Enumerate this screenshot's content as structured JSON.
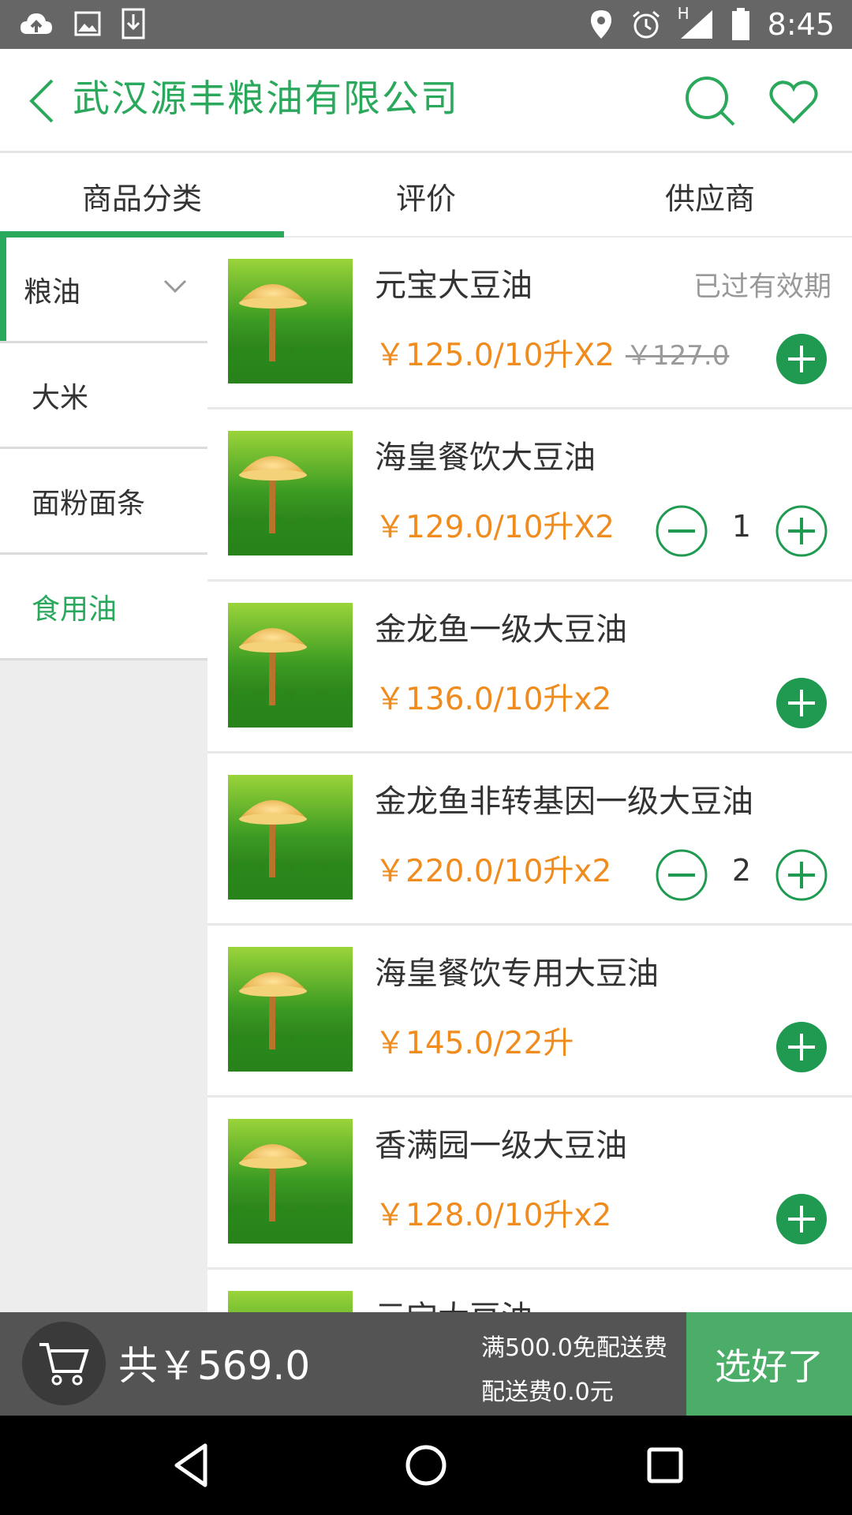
{
  "status_bar": {
    "time": "8:45",
    "network": "H"
  },
  "header": {
    "title": "武汉源丰粮油有限公司"
  },
  "tabs": [
    {
      "label": "商品分类",
      "active": true
    },
    {
      "label": "评价",
      "active": false
    },
    {
      "label": "供应商",
      "active": false
    }
  ],
  "sidebar": {
    "items": [
      {
        "label": "粮油"
      },
      {
        "label": "大米"
      },
      {
        "label": "面粉面条"
      },
      {
        "label": "食用油"
      }
    ]
  },
  "products": [
    {
      "name": "元宝大豆油",
      "price": "￥125.0/10升X2",
      "old_price": "￥127.0",
      "status": "已过有效期"
    },
    {
      "name": "海皇餐饮大豆油",
      "price": "￥129.0/10升X2",
      "qty": "1"
    },
    {
      "name": "金龙鱼一级大豆油",
      "price": "￥136.0/10升x2"
    },
    {
      "name": "金龙鱼非转基因一级大豆油",
      "price": "￥220.0/10升x2",
      "qty": "2"
    },
    {
      "name": "海皇餐饮专用大豆油",
      "price": "￥145.0/22升"
    },
    {
      "name": "香满园一级大豆油",
      "price": "￥128.0/10升x2"
    },
    {
      "name": "元宝大豆油"
    }
  ],
  "cart": {
    "total": "共￥569.0",
    "free_shipping": "满500.0免配送费",
    "shipping_fee": "配送费0.0元",
    "checkout_label": "选好了"
  },
  "colors": {
    "accent": "#2aa85c",
    "price": "#f08c1e",
    "checkout": "#4cad68"
  }
}
